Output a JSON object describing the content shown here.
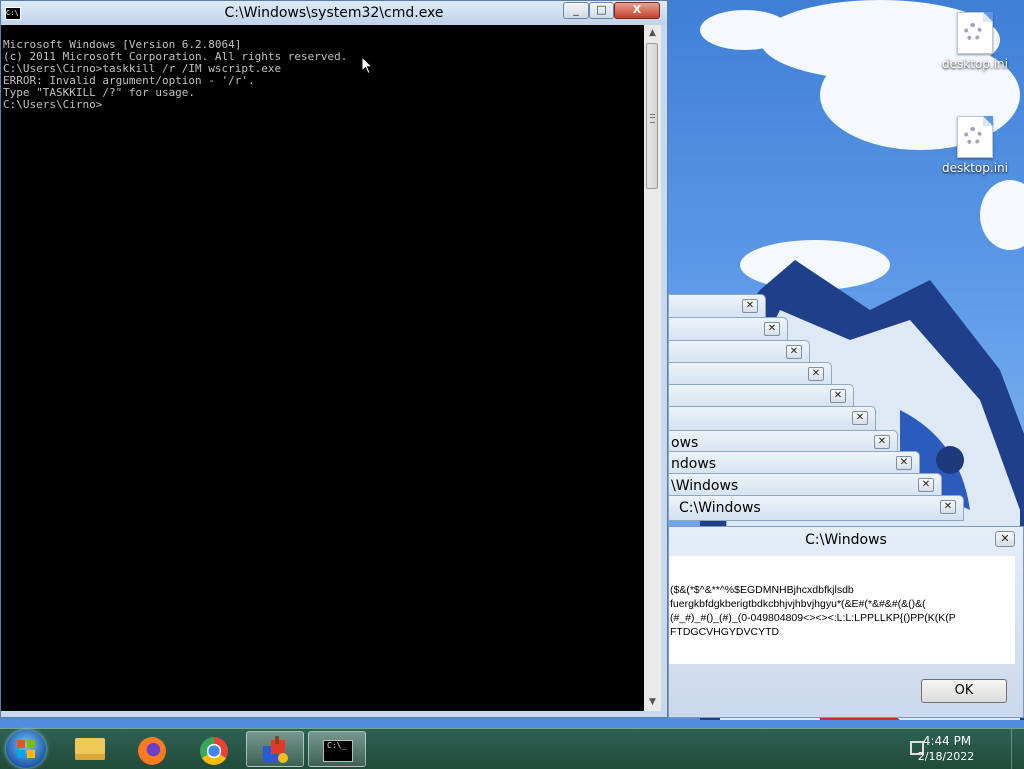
{
  "desktop": {
    "icons": [
      {
        "label": "desktop.ini"
      },
      {
        "label": "desktop.ini"
      }
    ]
  },
  "cmd": {
    "title": "C:\\Windows\\system32\\cmd.exe",
    "icon_text": "C:\\",
    "lines": [
      "Microsoft Windows [Version 6.2.8064]",
      "(c) 2011 Microsoft Corporation. All rights reserved.",
      "",
      "C:\\Users\\Cirno>taskkill /r /IM wscript.exe",
      "ERROR: Invalid argument/option - '/r'.",
      "Type \"TASKKILL /?\" for usage.",
      "",
      "C:\\Users\\Cirno>"
    ],
    "buttons": {
      "minimize": "_",
      "maximize": "□",
      "close": "X"
    }
  },
  "stacked_dialogs": [
    {
      "title": ""
    },
    {
      "title": ""
    },
    {
      "title": ""
    },
    {
      "title": ""
    },
    {
      "title": ""
    },
    {
      "title": ""
    },
    {
      "title": "ows"
    },
    {
      "title": "ndows"
    },
    {
      "title": "\\Windows"
    },
    {
      "title": "C:\\Windows"
    }
  ],
  "front_dialog": {
    "title": "C:\\Windows",
    "close_label": "X",
    "message": "($&(*$^&**^%$EGDMNHBjhcxdbfkjlsdb\nfuergkbfdgkberigtbdkcbhjvjhbvjhgyu*(&E#(*&#&#(&()&(\n(#_#)_#()_(#)_(0-049804809<><><:L:L:LPPLLKP{()PP(K(K(P\nFTDGCVHGYDVCYTD",
    "ok_label": "OK"
  },
  "taskbar": {
    "items": [
      {
        "name": "explorer"
      },
      {
        "name": "firefox"
      },
      {
        "name": "chrome"
      },
      {
        "name": "paint-app"
      },
      {
        "name": "cmd"
      }
    ],
    "cmd_icon_text": "C:\\_",
    "clock": {
      "time": "4:44 PM",
      "date": "2/18/2022"
    }
  },
  "colors": {
    "console_bg": "#000000",
    "console_fg": "#c0c0c0",
    "taskbar": "#2f5a3f"
  }
}
